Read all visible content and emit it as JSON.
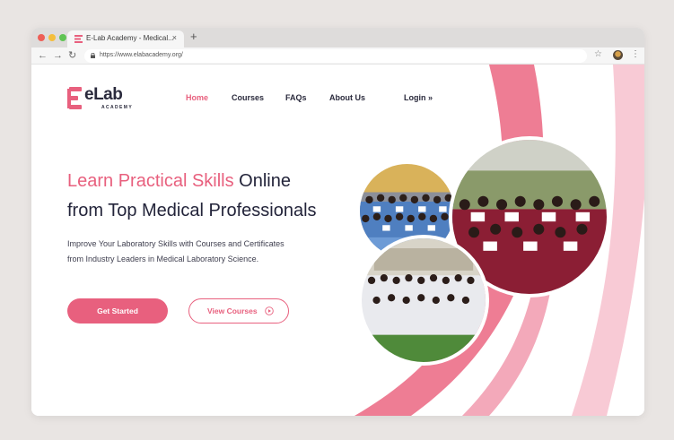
{
  "browser": {
    "tab_title": "E-Lab Academy - Medical...",
    "tab_close": "×",
    "new_tab": "+",
    "url": "https://www.elabacademy.org/",
    "back": "←",
    "forward": "→",
    "reload": "↻",
    "star": "☆",
    "menu": "⋮"
  },
  "logo": {
    "word": "eLab",
    "sub": "ACADEMY"
  },
  "nav": {
    "home": "Home",
    "courses": "Courses",
    "faqs": "FAQs",
    "about": "About Us",
    "login": "Login »"
  },
  "hero": {
    "headline_accent": "Learn Practical Skills",
    "headline_rest": " Online",
    "headline_line2": "from Top Medical Professionals",
    "sub_line1": "Improve Your Laboratory Skills with Courses and Certificates",
    "sub_line2": "from Industry Leaders in Medical Laboratory Science.",
    "cta_primary": "Get Started",
    "cta_secondary": "View Courses"
  },
  "colors": {
    "accent": "#e8607e",
    "dark": "#23243a"
  },
  "icons": {
    "play": "play-circle-icon",
    "lock": "lock-icon",
    "star": "star-icon",
    "profile": "profile-avatar"
  }
}
